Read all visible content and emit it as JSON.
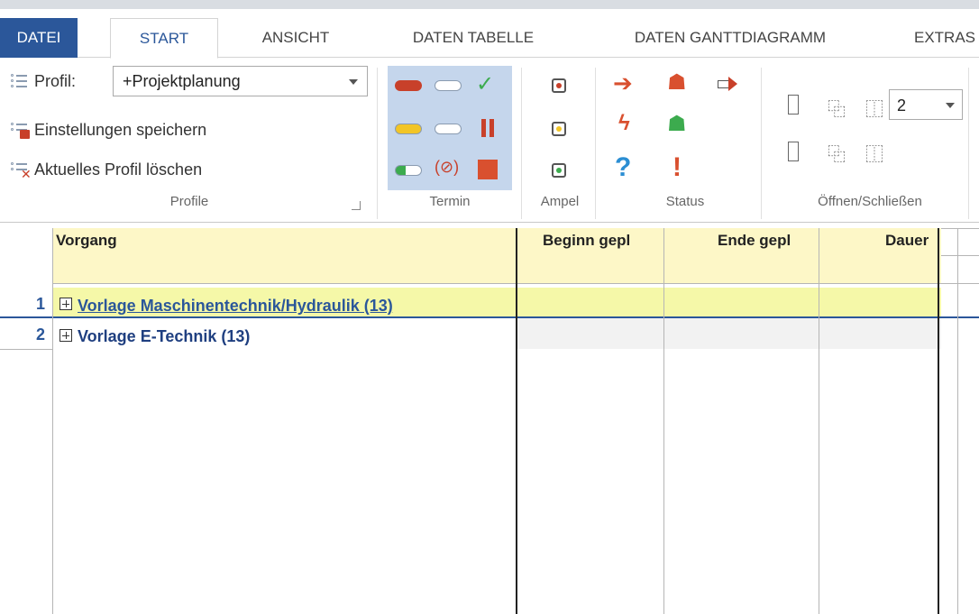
{
  "ribbon_tabs": [
    {
      "label": "DATEI"
    },
    {
      "label": "START"
    },
    {
      "label": "ANSICHT"
    },
    {
      "label": "DATEN TABELLE"
    },
    {
      "label": "DATEN GANTTDIAGRAMM"
    },
    {
      "label": "EXTRAS"
    }
  ],
  "profile_group": {
    "profile_label": "Profil:",
    "profile_value": "+Projektplanung",
    "save_label": "Einstellungen speichern",
    "delete_label": "Aktuelles Profil löschen",
    "group_label": "Profile"
  },
  "groups": {
    "termin": "Termin",
    "ampel": "Ampel",
    "status": "Status",
    "open_close": "Öffnen/Schließen"
  },
  "level_select": {
    "value": "2"
  },
  "table": {
    "columns": [
      "Vorgang",
      "Beginn gepl",
      "Ende gepl",
      "Dauer"
    ],
    "rows": [
      {
        "num": "1",
        "label": "Vorlage Maschinentechnik/Hydraulik (13)"
      },
      {
        "num": "2",
        "label": "Vorlage E-Technik (13)"
      }
    ]
  },
  "colors": {
    "accent": "#2b579a",
    "header_bg": "#fdf7c7",
    "selected_row_bg": "#f5f8a8",
    "termin_bg": "#c5d6ec"
  }
}
